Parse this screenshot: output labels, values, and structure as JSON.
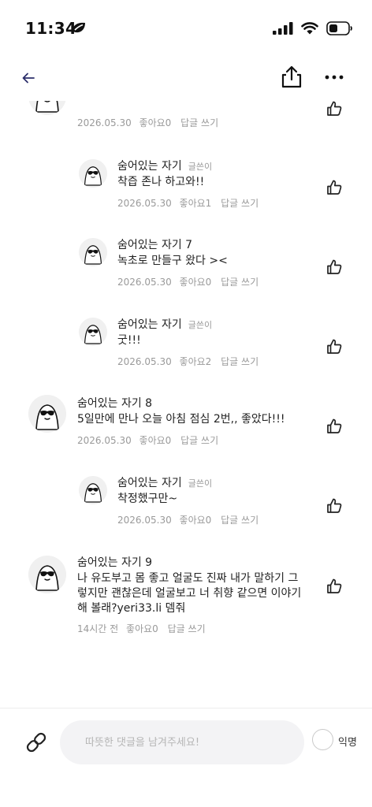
{
  "status_bar": {
    "time": "11:34"
  },
  "comments": [
    {
      "kind": "top",
      "name": "",
      "badge": "",
      "text": "",
      "date": "2026.05.30",
      "likes": "좋아요0",
      "reply": "답글 쓰기"
    },
    {
      "kind": "reply",
      "name": "숨어있는 자기",
      "badge": "글쓴이",
      "text": "착즙 존나 하고와!!",
      "date": "2026.05.30",
      "likes": "좋아요1",
      "reply": "답글 쓰기"
    },
    {
      "kind": "reply",
      "name": "숨어있는 자기 7",
      "badge": "",
      "text": "녹초로 만들구 왔다 ><",
      "date": "2026.05.30",
      "likes": "좋아요0",
      "reply": "답글 쓰기"
    },
    {
      "kind": "reply",
      "name": "숨어있는 자기",
      "badge": "글쓴이",
      "text": "굿!!!",
      "date": "2026.05.30",
      "likes": "좋아요2",
      "reply": "답글 쓰기"
    },
    {
      "kind": "top",
      "name": "숨어있는 자기 8",
      "badge": "",
      "text": "5일만에 만나 오늘 아침 점심 2번,, 좋았다!!!",
      "date": "2026.05.30",
      "likes": "좋아요0",
      "reply": "답글 쓰기"
    },
    {
      "kind": "reply",
      "name": "숨어있는 자기",
      "badge": "글쓴이",
      "text": "착정했구만~",
      "date": "2026.05.30",
      "likes": "좋아요0",
      "reply": "답글 쓰기"
    },
    {
      "kind": "top",
      "name": "숨어있는 자기 9",
      "badge": "",
      "text_lines": [
        "나 유도부고 몸 좋고 얼굴도 진짜 내가 말하기 그",
        "렇지만 괜찮은데 얼굴보고 너 취향 같으면 이야기",
        "해 볼래?yeri33.li 뎀줘"
      ],
      "date": "14시간 전",
      "likes": "좋아요0",
      "reply": "답글 쓰기"
    }
  ],
  "input": {
    "placeholder": "따뜻한 댓글을 남겨주세요!"
  },
  "anonymous": {
    "label": "익명",
    "checked": false
  },
  "colors": {
    "accent": "#2d2f6b",
    "muted": "#9a9a9a",
    "input_bg": "#f3f3f5"
  }
}
